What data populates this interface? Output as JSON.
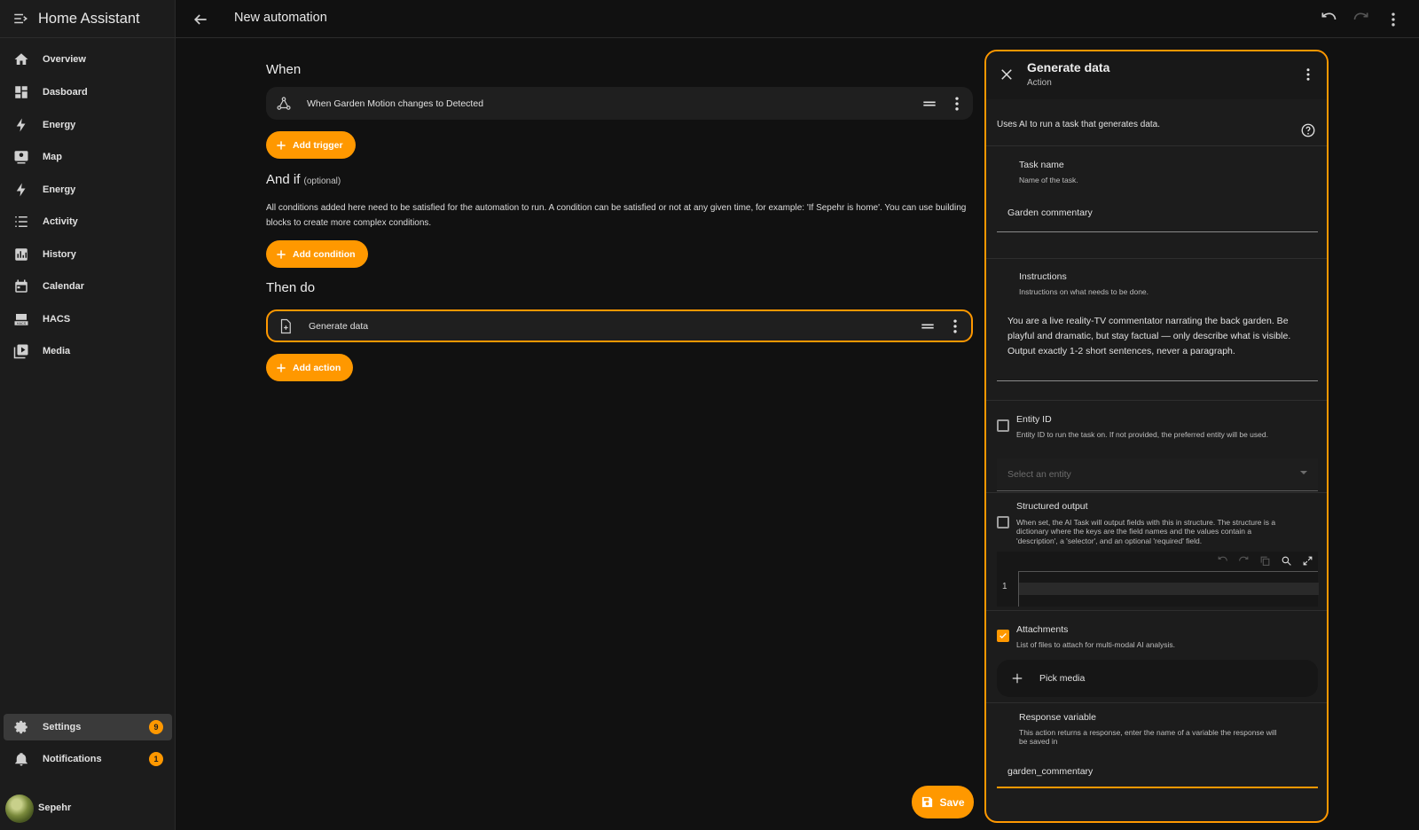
{
  "app": {
    "title": "Home Assistant"
  },
  "sidebar": {
    "items": [
      {
        "label": "Overview",
        "icon": "home-icon"
      },
      {
        "label": "Dasboard",
        "icon": "dashboard-icon"
      },
      {
        "label": "Energy",
        "icon": "lightning-icon"
      },
      {
        "label": "Map",
        "icon": "map-icon"
      },
      {
        "label": "Energy",
        "icon": "lightning-icon"
      },
      {
        "label": "Activity",
        "icon": "list-icon"
      },
      {
        "label": "History",
        "icon": "chart-icon"
      },
      {
        "label": "Calendar",
        "icon": "calendar-icon"
      },
      {
        "label": "HACS",
        "icon": "hacs-icon"
      },
      {
        "label": "Media",
        "icon": "media-icon"
      }
    ],
    "settings": {
      "label": "Settings",
      "badge": "9"
    },
    "notifications": {
      "label": "Notifications",
      "badge": "1"
    },
    "user": {
      "name": "Sepehr"
    }
  },
  "topbar": {
    "title": "New automation"
  },
  "editor": {
    "when": {
      "title": "When",
      "trigger_label": "When Garden Motion changes to Detected",
      "add_label": "Add trigger"
    },
    "and_if": {
      "title": "And if",
      "optional": "(optional)",
      "description": "All conditions added here need to be satisfied for the automation to run. A condition can be satisfied or not at any given time, for example: 'If Sepehr is home'. You can use building blocks to create more complex conditions.",
      "add_label": "Add condition"
    },
    "then_do": {
      "title": "Then do",
      "action_label": "Generate data",
      "add_label": "Add action"
    },
    "save_label": "Save"
  },
  "panel": {
    "title": "Generate data",
    "subtitle": "Action",
    "description": "Uses AI to run a task that generates data.",
    "task_name": {
      "label": "Task name",
      "hint": "Name of the task.",
      "value": "Garden commentary"
    },
    "instructions": {
      "label": "Instructions",
      "hint": "Instructions on what needs to be done.",
      "lines": [
        "You are a live reality-TV commentator narrating the back garden. Be",
        "playful and dramatic, but stay factual — only describe what is visible.",
        "Output exactly 1-2 short sentences, never a paragraph."
      ]
    },
    "entity_id": {
      "label": "Entity ID",
      "hint": "Entity ID to run the task on. If not provided, the preferred entity will be used.",
      "placeholder": "Select an entity",
      "checked": false
    },
    "structured_output": {
      "label": "Structured output",
      "hint_lines": [
        "When set, the AI Task will output fields with this in structure. The structure is a",
        "dictionary where the keys are the field names and the values contain a",
        "'description', a 'selector', and an optional 'required' field."
      ],
      "checked": false,
      "line_number": "1"
    },
    "attachments": {
      "label": "Attachments",
      "hint": "List of files to attach for multi-modal AI analysis.",
      "checked": true,
      "pick_label": "Pick media"
    },
    "response_variable": {
      "label": "Response variable",
      "hint_lines": [
        "This action returns a response, enter the name of a variable the response will",
        "be saved in"
      ],
      "value": "garden_commentary"
    }
  },
  "colors": {
    "accent": "#ff9800",
    "background": "#111111",
    "surface": "#1c1c1c"
  }
}
